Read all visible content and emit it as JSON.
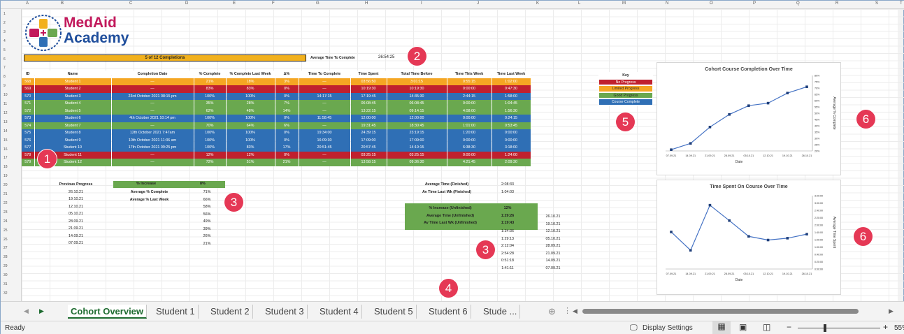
{
  "columns": [
    "A",
    "B",
    "C",
    "D",
    "E",
    "F",
    "G",
    "H",
    "I",
    "J",
    "K",
    "L",
    "M",
    "N",
    "O",
    "P",
    "Q",
    "R",
    "S",
    "T"
  ],
  "rows": [
    "1",
    "2",
    "3",
    "4",
    "5",
    "6",
    "7",
    "8",
    "9",
    "10",
    "11",
    "12",
    "13",
    "14",
    "15",
    "16",
    "17",
    "18",
    "19",
    "20",
    "21",
    "22",
    "23",
    "24",
    "25",
    "26",
    "27",
    "28",
    "29",
    "30",
    "31",
    "32"
  ],
  "logo": {
    "line1": "MedAid",
    "line2": "Academy"
  },
  "banner": "5 of 12 Completions",
  "avg_time": {
    "label": "Average Time To Complete",
    "value": "26:54:25"
  },
  "badges": [
    "1",
    "2",
    "3",
    "3",
    "4",
    "5",
    "6",
    "6"
  ],
  "table": {
    "headers": [
      "ID",
      "Name",
      "Completion Date",
      "% Complete",
      "% Complete Last Week",
      "Δ%",
      "Time To Complete",
      "Time Spent",
      "Total Time Before",
      "Time This Week",
      "Time Last Week"
    ],
    "rows": [
      {
        "status": "orange",
        "cells": [
          "568",
          "Student 1",
          "—",
          "21%",
          "18%",
          "3%",
          "—",
          "03:56:50",
          "3:01:15",
          "0:55:15",
          "1:02:00"
        ]
      },
      {
        "status": "red",
        "cells": [
          "569",
          "Student 2",
          "—",
          "83%",
          "83%",
          "0%",
          "—",
          "10:19:30",
          "10:19:30",
          "0:00:00",
          "0:47:30"
        ]
      },
      {
        "status": "blue",
        "cells": [
          "570",
          "Student 3",
          "23rd October 2021 08:15 pm",
          "100%",
          "100%",
          "0%",
          "14:17:15",
          "17:19:45",
          "14:35:30",
          "2:44:15",
          "1:58:00"
        ]
      },
      {
        "status": "green",
        "cells": [
          "571",
          "Student 4",
          "—",
          "35%",
          "28%",
          "7%",
          "—",
          "06:08:45",
          "06:08:45",
          "0:00:00",
          "1:04:45"
        ]
      },
      {
        "status": "green",
        "cells": [
          "572",
          "Student 5",
          "—",
          "62%",
          "48%",
          "14%",
          "—",
          "13:22:15",
          "09:14:15",
          "4:08:00",
          "1:56:30"
        ]
      },
      {
        "status": "blue",
        "cells": [
          "573",
          "Student 6",
          "4th October 2021 10:14 pm",
          "100%",
          "100%",
          "0%",
          "11:58:45",
          "12:00:00",
          "12:00:00",
          "0:00:00",
          "0:24:15"
        ]
      },
      {
        "status": "green",
        "cells": [
          "574",
          "Student 7",
          "—",
          "70%",
          "64%",
          "6%",
          "—",
          "19:31:45",
          "18:30:45",
          "1:01:00",
          "0:53:45"
        ]
      },
      {
        "status": "blue",
        "cells": [
          "575",
          "Student 8",
          "12th October 2021 7:47am",
          "100%",
          "100%",
          "0%",
          "19:34:00",
          "24:39:15",
          "23:19:15",
          "1:20:00",
          "0:00:00"
        ]
      },
      {
        "status": "blue",
        "cells": [
          "576",
          "Student 9",
          "10th October 2021 11:36 am",
          "100%",
          "100%",
          "0%",
          "16:09:30",
          "17:09:00",
          "17:09:00",
          "0:00:00",
          "0:00:00"
        ]
      },
      {
        "status": "blue",
        "cells": [
          "577",
          "Student 10",
          "17th October 2021 09:25 pm",
          "100%",
          "83%",
          "17%",
          "20:51:45",
          "20:57:45",
          "14:19:15",
          "6:38:30",
          "3:18:00"
        ]
      },
      {
        "status": "red",
        "cells": [
          "578",
          "Student 11",
          "—",
          "12%",
          "12%",
          "0%",
          "—",
          "03:25:15",
          "03:25:15",
          "0:00:00",
          "1:24:00"
        ]
      },
      {
        "status": "green",
        "cells": [
          "579",
          "Student 12",
          "—",
          "72%",
          "51%",
          "21%",
          "—",
          "13:58:15",
          "09:36:30",
          "4:21:45",
          "2:09:30"
        ]
      }
    ]
  },
  "key": {
    "title": "Key",
    "items": [
      "No Progress",
      "Limited Progress",
      "Good Progress",
      "Course Complete"
    ],
    "colors": [
      "#c0202e",
      "#f5a623",
      "#6aa84f",
      "#2f6fb5"
    ]
  },
  "previous_progress": {
    "header": "Previous Progress",
    "dates": [
      "26.10.21",
      "19.10.21",
      "12.10.21",
      "05.10.21",
      "28.09.21",
      "21.09.21",
      "14.09.21",
      "07.09.21"
    ],
    "pct_header": "% Increase",
    "pct_header_val": "8%",
    "pcts": [
      "71%",
      "66%",
      "58%",
      "56%",
      "49%",
      "39%",
      "26%",
      "21%"
    ]
  },
  "avg_stats": {
    "labels": [
      "Average % Complete",
      "Average % Last Week"
    ]
  },
  "time_stats": {
    "labels": [
      "Average Time (Finished)",
      "Av Time Last Wk (Finished)"
    ],
    "values": [
      "2:08:33",
      "1:04:03"
    ],
    "u_labels": [
      "% Increase (Unfinished)",
      "Average Time (Unfinished)",
      "Av Time Last Wk (Unfinished)"
    ],
    "u_values": [
      "12%",
      "1:29:26",
      "1:19:43"
    ],
    "times": [
      "1:34:36",
      "1:29:13",
      "2:12:04",
      "2:54:28",
      "0:51:18",
      "1:41:11"
    ],
    "dates": [
      "26.10.21",
      "19.10.21",
      "12.10.21",
      "05.10.21",
      "28.09.21",
      "21.09.21",
      "14.09.21",
      "07.09.21"
    ]
  },
  "chart_data": [
    {
      "type": "line",
      "title": "Cohort Course Completion Over Time",
      "xlabel": "Date",
      "ylabel": "Average % Complete",
      "x": [
        "07.09.21",
        "14.09.21",
        "21.09.21",
        "28.09.21",
        "05.10.21",
        "12.10.21",
        "19.10.21",
        "26.10.21"
      ],
      "values": [
        21,
        26,
        39,
        49,
        56,
        58,
        66,
        71
      ],
      "ylim": [
        20,
        80
      ],
      "yticks": [
        "20%",
        "25%",
        "30%",
        "35%",
        "40%",
        "45%",
        "50%",
        "55%",
        "60%",
        "65%",
        "70%",
        "75%",
        "80%"
      ]
    },
    {
      "type": "line",
      "title": "Time Spent On Course Over Time",
      "xlabel": "Date",
      "ylabel": "Average Time Spent",
      "x": [
        "07.09.21",
        "14.09.21",
        "21.09.21",
        "28.09.21",
        "05.10.21",
        "12.10.21",
        "19.10.21",
        "26.10.21"
      ],
      "values_minutes": [
        101,
        51,
        174,
        132,
        89,
        79,
        84,
        95
      ],
      "values": [
        "1:41:11",
        "0:51:18",
        "2:54:28",
        "2:12:04",
        "1:29:13",
        "1:19:43",
        "1:24:00",
        "1:34:36"
      ],
      "ylim_minutes": [
        0,
        200
      ],
      "yticks": [
        "0:00:00",
        "0:20:00",
        "0:40:00",
        "1:00:00",
        "1:20:00",
        "1:40:00",
        "2:00:00",
        "2:20:00",
        "2:40:00",
        "3:00:00",
        "3:20:00"
      ]
    }
  ],
  "tabs": [
    "Cohort Overview",
    "Student 1",
    "Student 2",
    "Student 3",
    "Student 4",
    "Student 5",
    "Student 6",
    "Stude ..."
  ],
  "status": {
    "ready": "Ready",
    "display_settings": "Display Settings",
    "zoom": "55%"
  },
  "colors": {
    "accent": "#1e6b30",
    "badge": "#e53855"
  }
}
